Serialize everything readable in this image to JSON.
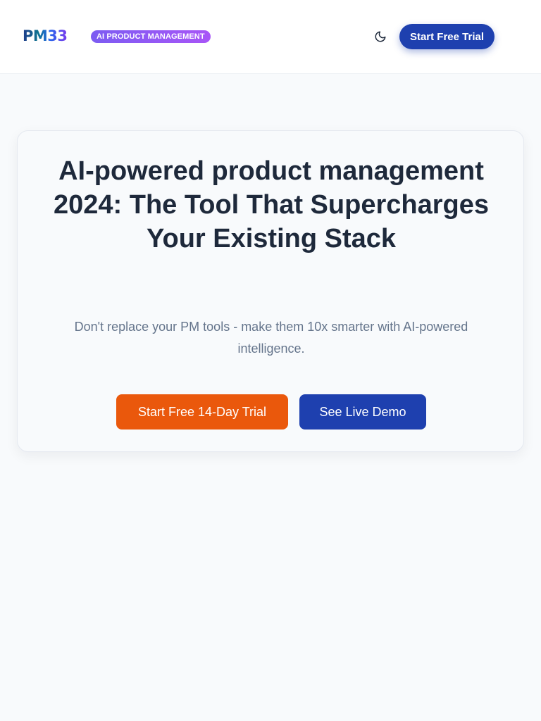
{
  "header": {
    "logo_text": "PM33",
    "badge": "AI PRODUCT MANAGEMENT",
    "theme_toggle_icon": "moon-icon",
    "cta_label": "Start Free Trial"
  },
  "hero": {
    "title": "AI-powered product management 2024: The Tool That Supercharges Your Existing Stack",
    "subtitle": "Don't replace your PM tools - make them 10x smarter with AI-powered intelligence.",
    "primary_cta": "Start Free 14-Day Trial",
    "secondary_cta": "See Live Demo"
  },
  "colors": {
    "page_background": "#f8fafc",
    "brand_blue": "#1e40af",
    "accent_orange": "#ea580c",
    "badge_purple": "#8b5cf6",
    "heading_text": "#1e293b",
    "muted_text": "#64748b"
  }
}
